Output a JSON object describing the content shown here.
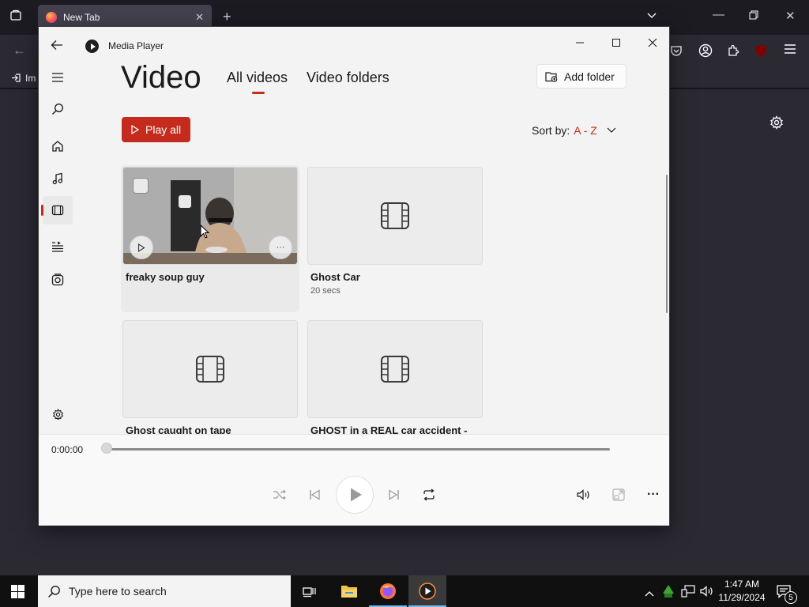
{
  "browser": {
    "tab_title": "New Tab",
    "bookmark_label": "Im"
  },
  "window": {
    "title": "Media Player"
  },
  "page": {
    "heading": "Video",
    "tabs": [
      {
        "label": "All videos",
        "selected": true
      },
      {
        "label": "Video folders",
        "selected": false
      }
    ],
    "add_folder_label": "Add folder",
    "play_all_label": "Play all",
    "sort_label": "Sort by:",
    "sort_value": "A - Z"
  },
  "videos": [
    {
      "title": "freaky soup guy",
      "subtitle": ""
    },
    {
      "title": "Ghost Car",
      "subtitle": "20 secs"
    },
    {
      "title": "Ghost caught on tape",
      "subtitle": ""
    },
    {
      "title": "GHOST in a REAL car accident -",
      "subtitle": ""
    }
  ],
  "player": {
    "time": "0:00:00",
    "progress": 0
  },
  "taskbar": {
    "search_placeholder": "Type here to search",
    "time": "1:47 AM",
    "date": "11/29/2024",
    "notification_count": "5"
  },
  "colors": {
    "accent": "#c42b1c",
    "window_bg": "#f3f3f3",
    "browser_bg": "#2b2a33",
    "taskbar_bg": "#101010"
  }
}
